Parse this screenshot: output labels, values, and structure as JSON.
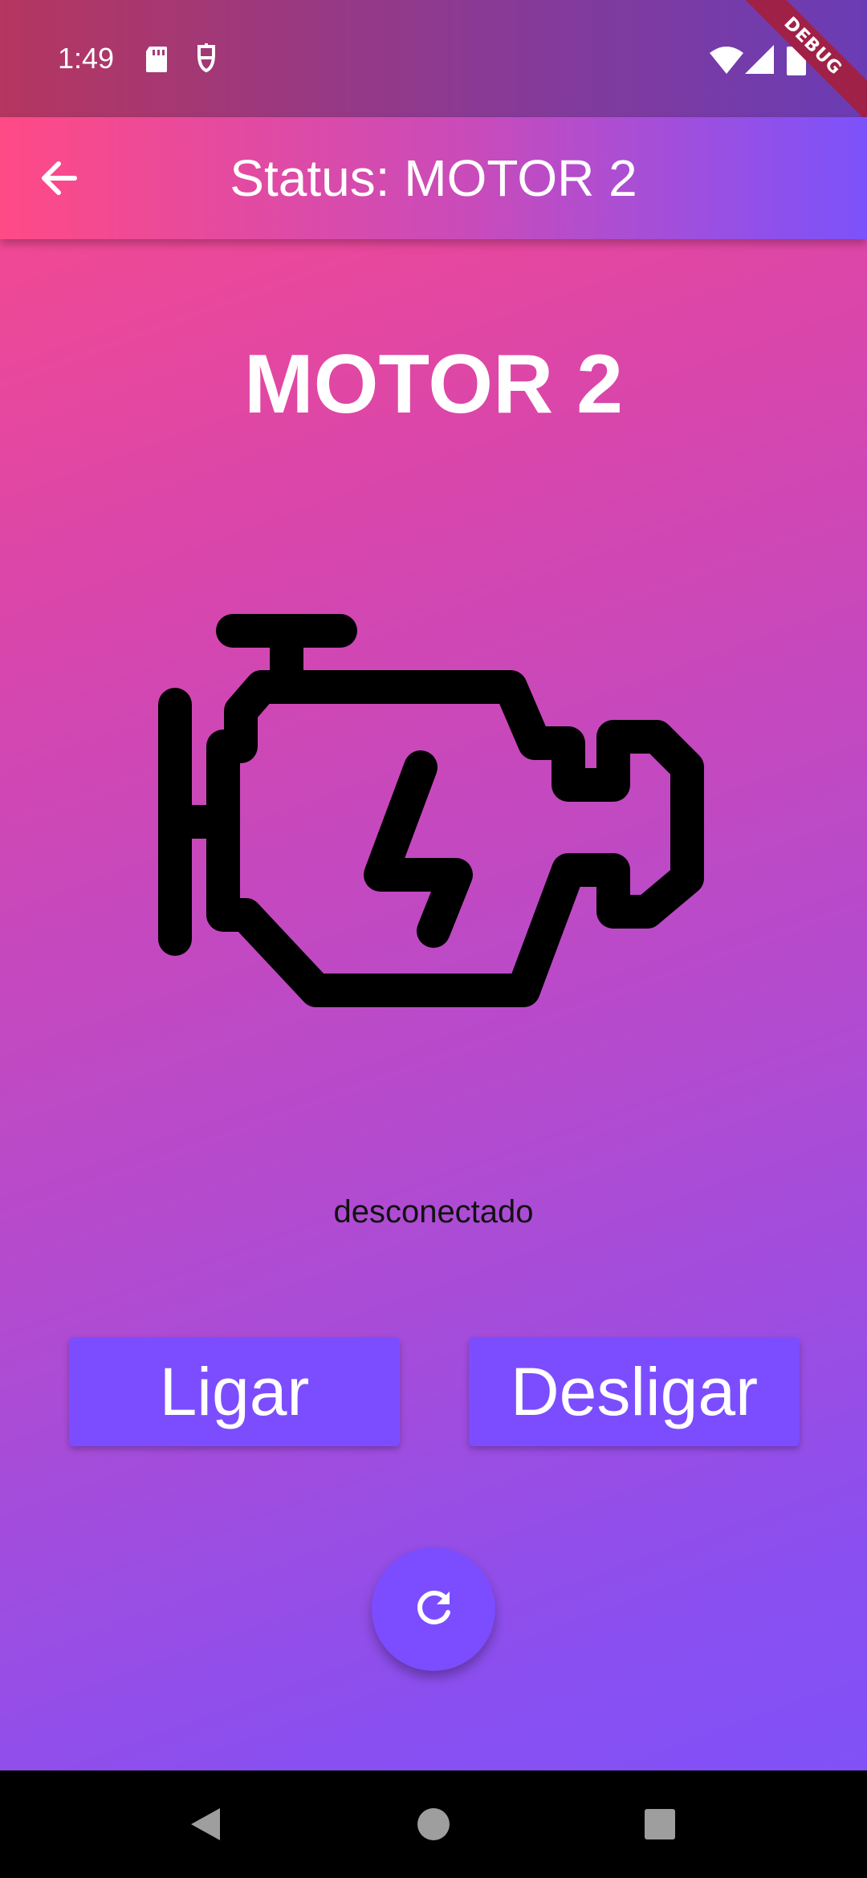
{
  "status_bar": {
    "time": "1:49",
    "icons": [
      "sd-card-icon",
      "assistant-icon",
      "wifi-icon",
      "signal-icon",
      "battery-icon"
    ]
  },
  "debug_banner": "DEBUG",
  "app_bar": {
    "back_icon": "arrow-back-icon",
    "title": "Status: MOTOR 2"
  },
  "main": {
    "heading": "MOTOR 2",
    "engine_icon": "engine-check-icon",
    "status": "desconectado",
    "on_label": "Ligar",
    "off_label": "Desligar",
    "refresh_icon": "refresh-icon"
  },
  "nav_bar": {
    "icons": [
      "nav-back-icon",
      "nav-home-icon",
      "nav-recents-icon"
    ]
  },
  "colors": {
    "gradient_start": "#ff4a86",
    "gradient_end": "#7c52fb",
    "button": "#7c4dff",
    "debug_banner": "#a02147"
  }
}
